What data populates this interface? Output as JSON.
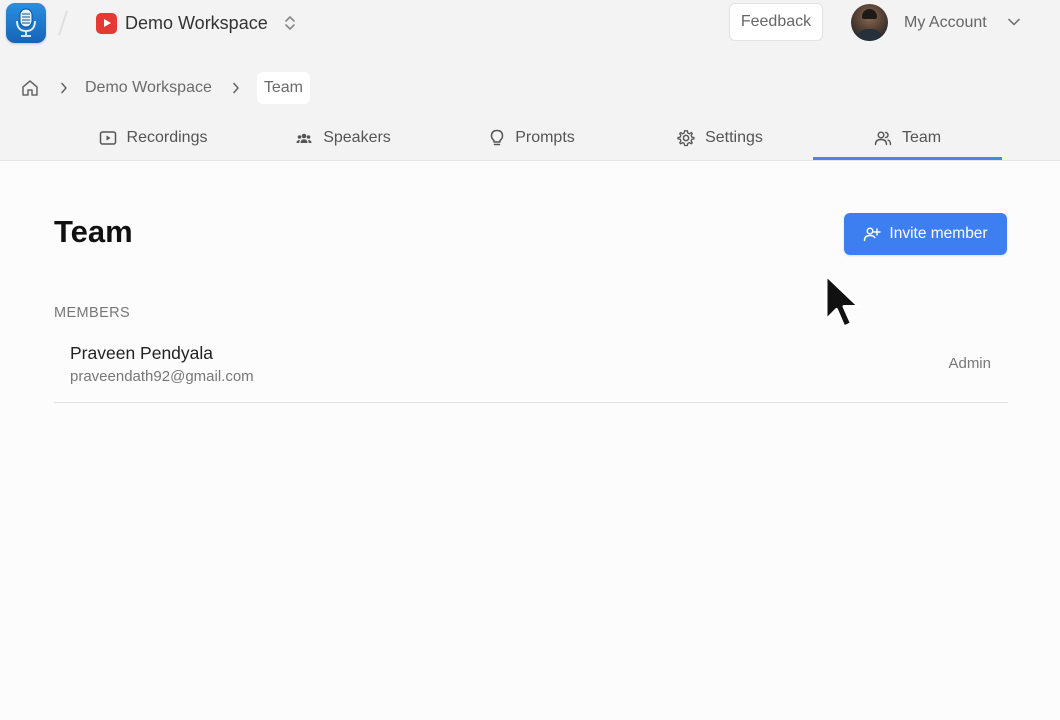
{
  "header": {
    "workspace_name": "Demo Workspace",
    "feedback_label": "Feedback",
    "account_label": "My Account"
  },
  "breadcrumb": {
    "items": [
      "Demo Workspace",
      "Team"
    ]
  },
  "tabs": [
    {
      "label": "Recordings",
      "icon": "play-square-icon"
    },
    {
      "label": "Speakers",
      "icon": "users-group-icon"
    },
    {
      "label": "Prompts",
      "icon": "lightbulb-icon"
    },
    {
      "label": "Settings",
      "icon": "gear-icon"
    },
    {
      "label": "Team",
      "icon": "users-icon",
      "active": true
    }
  ],
  "main": {
    "title": "Team",
    "invite_label": "Invite member",
    "members_heading": "MEMBERS",
    "members": [
      {
        "name": "Praveen Pendyala",
        "email": "praveendath92@gmail.com",
        "role": "Admin"
      }
    ]
  },
  "colors": {
    "accent": "#3d7ff0",
    "active_tab_underline": "#4a86e8",
    "workspace_icon": "#e53935",
    "header_bg": "#f3f3f3"
  }
}
